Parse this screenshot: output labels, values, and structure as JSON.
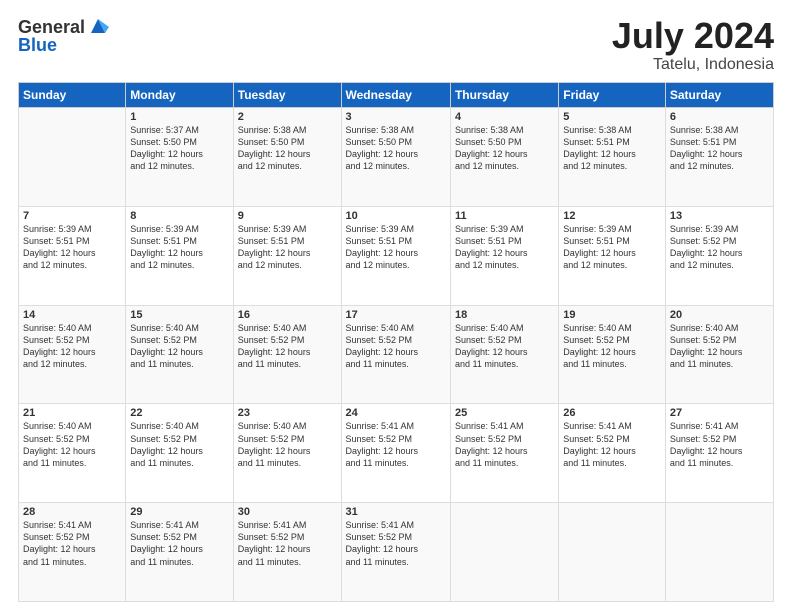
{
  "logo": {
    "general": "General",
    "blue": "Blue"
  },
  "title": {
    "month_year": "July 2024",
    "location": "Tatelu, Indonesia"
  },
  "days_header": [
    "Sunday",
    "Monday",
    "Tuesday",
    "Wednesday",
    "Thursday",
    "Friday",
    "Saturday"
  ],
  "weeks": [
    [
      {
        "day": "",
        "info": ""
      },
      {
        "day": "1",
        "info": "Sunrise: 5:37 AM\nSunset: 5:50 PM\nDaylight: 12 hours\nand 12 minutes."
      },
      {
        "day": "2",
        "info": "Sunrise: 5:38 AM\nSunset: 5:50 PM\nDaylight: 12 hours\nand 12 minutes."
      },
      {
        "day": "3",
        "info": "Sunrise: 5:38 AM\nSunset: 5:50 PM\nDaylight: 12 hours\nand 12 minutes."
      },
      {
        "day": "4",
        "info": "Sunrise: 5:38 AM\nSunset: 5:50 PM\nDaylight: 12 hours\nand 12 minutes."
      },
      {
        "day": "5",
        "info": "Sunrise: 5:38 AM\nSunset: 5:51 PM\nDaylight: 12 hours\nand 12 minutes."
      },
      {
        "day": "6",
        "info": "Sunrise: 5:38 AM\nSunset: 5:51 PM\nDaylight: 12 hours\nand 12 minutes."
      }
    ],
    [
      {
        "day": "7",
        "info": "Sunrise: 5:39 AM\nSunset: 5:51 PM\nDaylight: 12 hours\nand 12 minutes."
      },
      {
        "day": "8",
        "info": "Sunrise: 5:39 AM\nSunset: 5:51 PM\nDaylight: 12 hours\nand 12 minutes."
      },
      {
        "day": "9",
        "info": "Sunrise: 5:39 AM\nSunset: 5:51 PM\nDaylight: 12 hours\nand 12 minutes."
      },
      {
        "day": "10",
        "info": "Sunrise: 5:39 AM\nSunset: 5:51 PM\nDaylight: 12 hours\nand 12 minutes."
      },
      {
        "day": "11",
        "info": "Sunrise: 5:39 AM\nSunset: 5:51 PM\nDaylight: 12 hours\nand 12 minutes."
      },
      {
        "day": "12",
        "info": "Sunrise: 5:39 AM\nSunset: 5:51 PM\nDaylight: 12 hours\nand 12 minutes."
      },
      {
        "day": "13",
        "info": "Sunrise: 5:39 AM\nSunset: 5:52 PM\nDaylight: 12 hours\nand 12 minutes."
      }
    ],
    [
      {
        "day": "14",
        "info": "Sunrise: 5:40 AM\nSunset: 5:52 PM\nDaylight: 12 hours\nand 12 minutes."
      },
      {
        "day": "15",
        "info": "Sunrise: 5:40 AM\nSunset: 5:52 PM\nDaylight: 12 hours\nand 11 minutes."
      },
      {
        "day": "16",
        "info": "Sunrise: 5:40 AM\nSunset: 5:52 PM\nDaylight: 12 hours\nand 11 minutes."
      },
      {
        "day": "17",
        "info": "Sunrise: 5:40 AM\nSunset: 5:52 PM\nDaylight: 12 hours\nand 11 minutes."
      },
      {
        "day": "18",
        "info": "Sunrise: 5:40 AM\nSunset: 5:52 PM\nDaylight: 12 hours\nand 11 minutes."
      },
      {
        "day": "19",
        "info": "Sunrise: 5:40 AM\nSunset: 5:52 PM\nDaylight: 12 hours\nand 11 minutes."
      },
      {
        "day": "20",
        "info": "Sunrise: 5:40 AM\nSunset: 5:52 PM\nDaylight: 12 hours\nand 11 minutes."
      }
    ],
    [
      {
        "day": "21",
        "info": "Sunrise: 5:40 AM\nSunset: 5:52 PM\nDaylight: 12 hours\nand 11 minutes."
      },
      {
        "day": "22",
        "info": "Sunrise: 5:40 AM\nSunset: 5:52 PM\nDaylight: 12 hours\nand 11 minutes."
      },
      {
        "day": "23",
        "info": "Sunrise: 5:40 AM\nSunset: 5:52 PM\nDaylight: 12 hours\nand 11 minutes."
      },
      {
        "day": "24",
        "info": "Sunrise: 5:41 AM\nSunset: 5:52 PM\nDaylight: 12 hours\nand 11 minutes."
      },
      {
        "day": "25",
        "info": "Sunrise: 5:41 AM\nSunset: 5:52 PM\nDaylight: 12 hours\nand 11 minutes."
      },
      {
        "day": "26",
        "info": "Sunrise: 5:41 AM\nSunset: 5:52 PM\nDaylight: 12 hours\nand 11 minutes."
      },
      {
        "day": "27",
        "info": "Sunrise: 5:41 AM\nSunset: 5:52 PM\nDaylight: 12 hours\nand 11 minutes."
      }
    ],
    [
      {
        "day": "28",
        "info": "Sunrise: 5:41 AM\nSunset: 5:52 PM\nDaylight: 12 hours\nand 11 minutes."
      },
      {
        "day": "29",
        "info": "Sunrise: 5:41 AM\nSunset: 5:52 PM\nDaylight: 12 hours\nand 11 minutes."
      },
      {
        "day": "30",
        "info": "Sunrise: 5:41 AM\nSunset: 5:52 PM\nDaylight: 12 hours\nand 11 minutes."
      },
      {
        "day": "31",
        "info": "Sunrise: 5:41 AM\nSunset: 5:52 PM\nDaylight: 12 hours\nand 11 minutes."
      },
      {
        "day": "",
        "info": ""
      },
      {
        "day": "",
        "info": ""
      },
      {
        "day": "",
        "info": ""
      }
    ]
  ]
}
